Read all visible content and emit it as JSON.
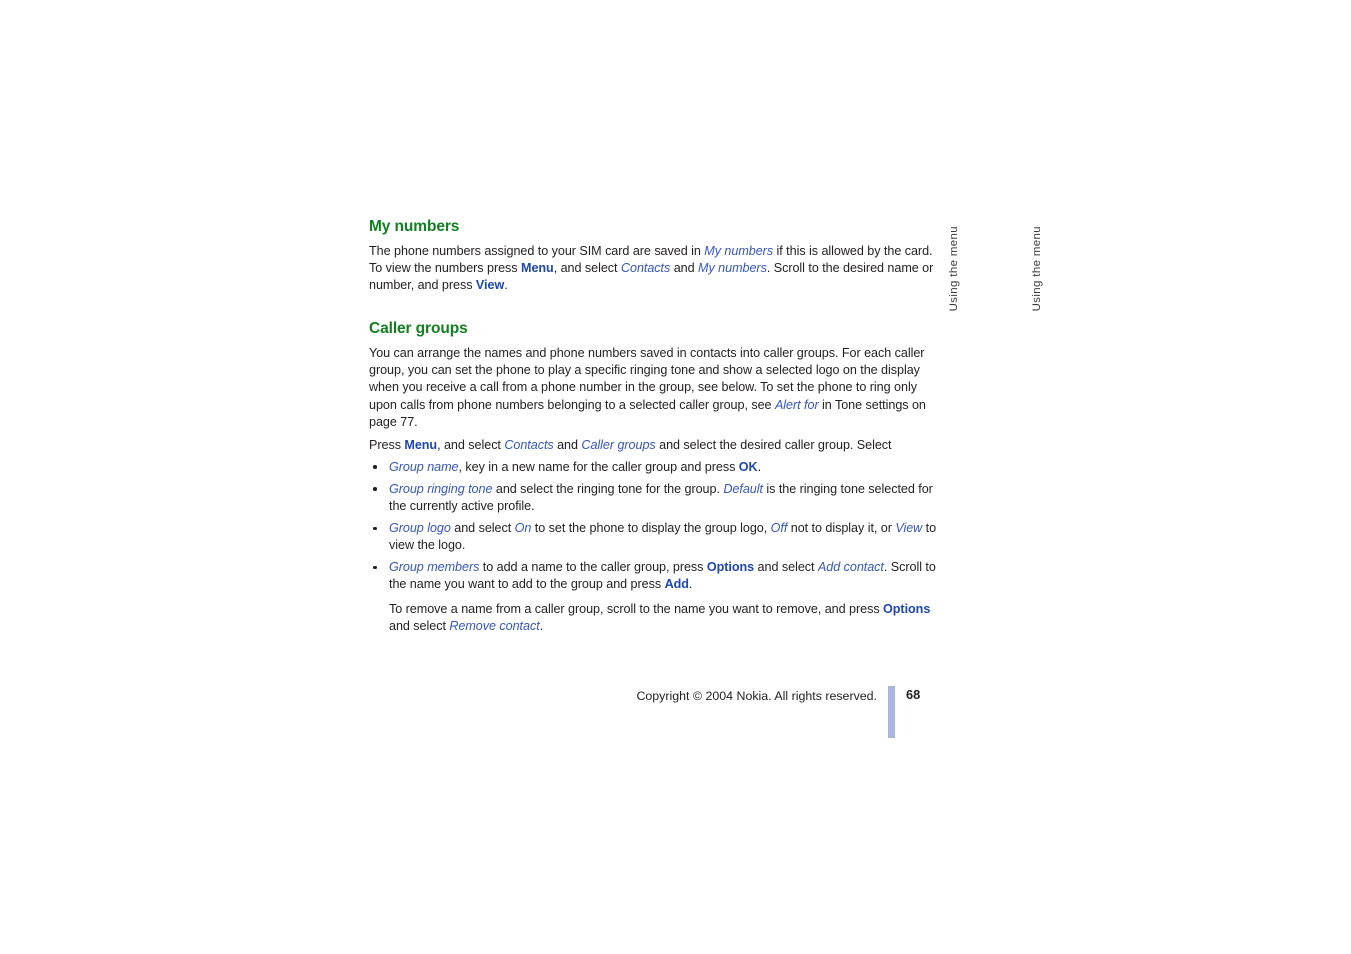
{
  "document": {
    "page_number": "68",
    "copyright": "Copyright © 2004 Nokia. All rights reserved.",
    "side_tabs": [
      {
        "label": "Using the menu"
      },
      {
        "label": "Using the menu"
      }
    ],
    "colors": {
      "heading_green": "#128020",
      "ui_blue_bold": "#1e46b4",
      "ui_blue_italic": "#3657bd",
      "body_text": "#231f20",
      "footer_rule": "#abb5de"
    }
  },
  "sections": [
    {
      "id": "my-numbers",
      "heading": "My numbers",
      "paragraph": {
        "p1_a": "The phone numbers assigned to your SIM card are saved in ",
        "p1_b": "My numbers",
        "p1_c": " if this is allowed by the card. To view the numbers press ",
        "p1_d": "Menu",
        "p1_e": ", and select ",
        "p1_f": "Contacts",
        "p1_g": " and ",
        "p1_h": "My numbers",
        "p1_i": ". Scroll to the desired name or number, and press ",
        "p1_j": "View",
        "p1_k": "."
      }
    },
    {
      "id": "caller-groups",
      "heading": "Caller groups",
      "intro": {
        "a": "You can arrange the names and phone numbers saved in contacts into caller groups. For each caller group, you can set the phone to play a specific ringing tone and show a selected logo on the display when you receive a call from a phone number in the group, see below. To set the phone to ring only upon calls from phone numbers belonging to a selected caller group, see ",
        "b": "Alert for",
        "c": " in Tone settings on page 77."
      },
      "lead": {
        "a": "Press ",
        "b": "Menu",
        "c": ", and select ",
        "d": "Contacts",
        "e": " and ",
        "f": "Caller groups",
        "g": " and select the desired caller group. Select"
      },
      "bullets": [
        {
          "a": "Group name",
          "b": ", key in a new name for the caller group and press ",
          "c": "OK",
          "d": "."
        },
        {
          "a": "Group ringing tone",
          "b": " and select the ringing tone for the group. ",
          "c": "Default",
          "d": " is the ringing tone selected for the currently active profile."
        },
        {
          "a": "Group logo",
          "b": " and select ",
          "c": "On",
          "d": " to set the phone to display the group logo, ",
          "e": "Off",
          "f": " not to display it, or ",
          "g": "View",
          "h": " to view the logo."
        },
        {
          "a": "Group members",
          "b": " to add a name to the caller group, press ",
          "c": "Options",
          "d": " and select ",
          "e": "Add contact",
          "f": ". Scroll to the name you want to add to the group and press ",
          "g": "Add",
          "h": "."
        }
      ],
      "remove_note": {
        "a": "To remove a name from a caller group, scroll to the name you want to remove, and press ",
        "b": "Options",
        "c": " and select ",
        "d": "Remove contact",
        "e": "."
      }
    }
  ]
}
